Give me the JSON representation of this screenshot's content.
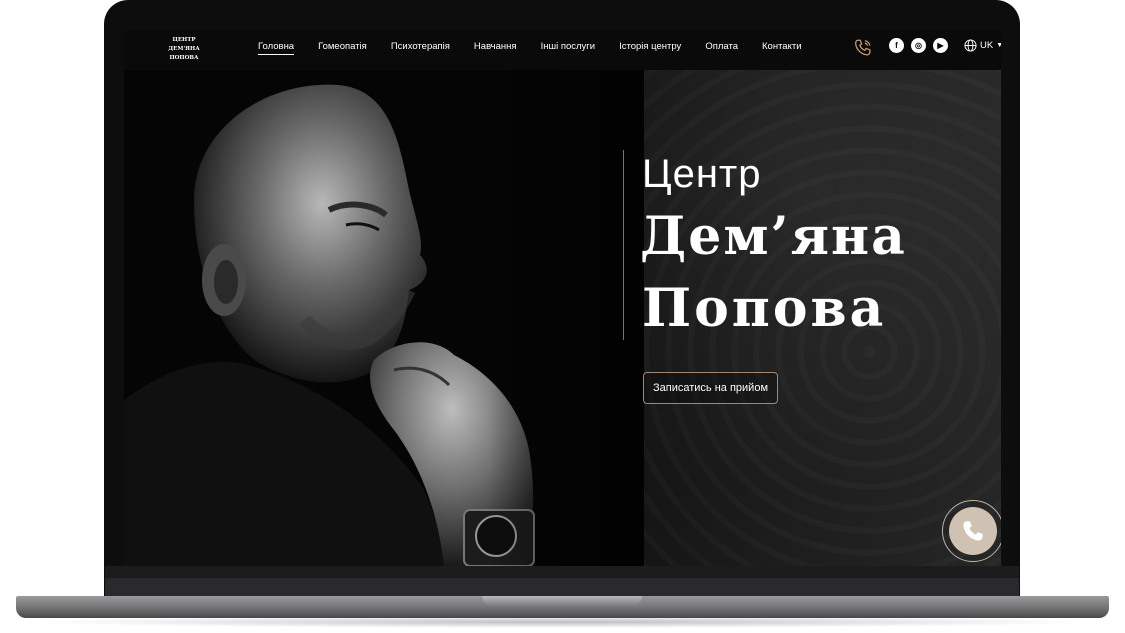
{
  "logo": {
    "line1": "ЦЕНТР",
    "line2": "ДЕМ'ЯНА",
    "line3": "ПОПОВА"
  },
  "nav": {
    "items": [
      {
        "label": "Головна",
        "active": true
      },
      {
        "label": "Гомеопатія"
      },
      {
        "label": "Психотерапія"
      },
      {
        "label": "Навчання"
      },
      {
        "label": "Інші послуги"
      },
      {
        "label": "Історія центру"
      },
      {
        "label": "Оплата"
      },
      {
        "label": "Контакти"
      }
    ]
  },
  "header_icons": {
    "phone": "phone-icon",
    "social": [
      {
        "name": "facebook-icon",
        "glyph": "f"
      },
      {
        "name": "instagram-icon",
        "glyph": "◎"
      },
      {
        "name": "youtube-icon",
        "glyph": "▶"
      }
    ],
    "language": {
      "icon": "globe-icon",
      "label": "UK"
    }
  },
  "hero": {
    "subtitle": "Центр",
    "name_line1": "Дем’яна",
    "name_line2": "Попова",
    "cta_label": "Записатись на прийом"
  },
  "colors": {
    "accent": "#c89a72",
    "cta_border": "#a78670",
    "call_button": "#cfc2b3",
    "background": "#121212"
  }
}
